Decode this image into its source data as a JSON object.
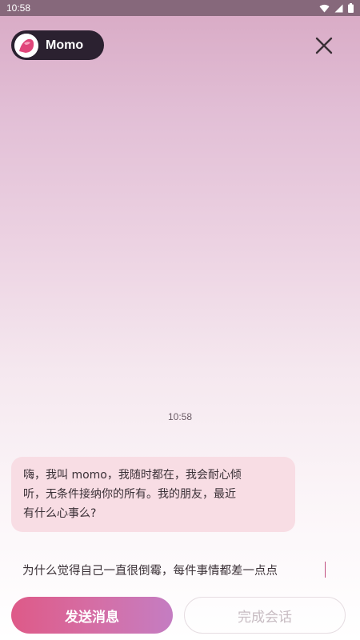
{
  "status_bar": {
    "time": "10:58"
  },
  "header": {
    "profile_name": "Momo",
    "close_icon": "close-icon"
  },
  "chat": {
    "timestamp": "10:58",
    "messages": [
      {
        "sender": "Momo",
        "lines": [
          "嗨，我叫 momo，我随时都在，我会耐心倾",
          "听，无条件接纳你的所有。我的朋友，最近",
          "有什么心事么?"
        ]
      }
    ]
  },
  "composer": {
    "input_value": "为什么觉得自己一直很倒霉，每件事情都差一点点"
  },
  "actions": {
    "send_label": "发送消息",
    "finish_label": "完成会话"
  },
  "colors": {
    "accent": "#de5a88",
    "bubble": "#f8dde4",
    "chip": "#2b2130"
  }
}
